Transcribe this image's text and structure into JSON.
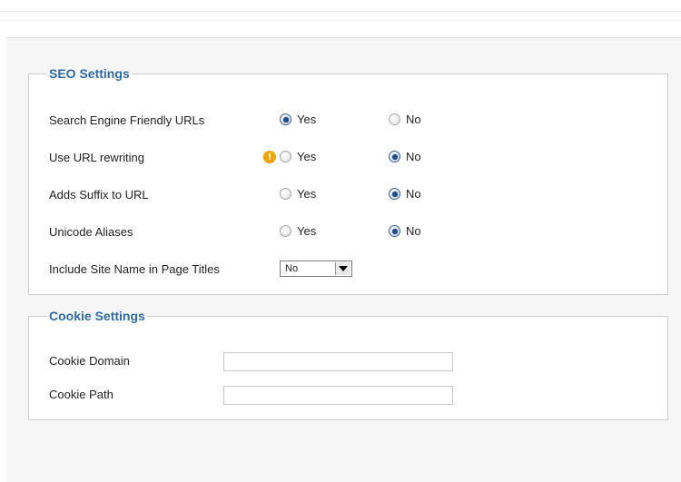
{
  "seo": {
    "legend": "SEO Settings",
    "rows": [
      {
        "label": "Search Engine Friendly URLs",
        "yes": "Yes",
        "no": "No",
        "selected": "yes"
      },
      {
        "label": "Use URL rewriting",
        "yes": "Yes",
        "no": "No",
        "selected": "no"
      },
      {
        "label": "Adds Suffix to URL",
        "yes": "Yes",
        "no": "No",
        "selected": "no"
      },
      {
        "label": "Unicode Aliases",
        "yes": "Yes",
        "no": "No",
        "selected": "no"
      }
    ],
    "site_name": {
      "label": "Include Site Name in Page Titles",
      "value": "No"
    }
  },
  "cookie": {
    "legend": "Cookie Settings",
    "domain_label": "Cookie Domain",
    "domain_value": "",
    "path_label": "Cookie Path",
    "path_value": ""
  },
  "colors": {
    "legend": "#2d6aa6",
    "warning": "#f0a500",
    "radio_checked": "#1f4e8c"
  },
  "icons": {
    "warning": "warning-icon",
    "dropdown": "chevron-down-icon"
  }
}
